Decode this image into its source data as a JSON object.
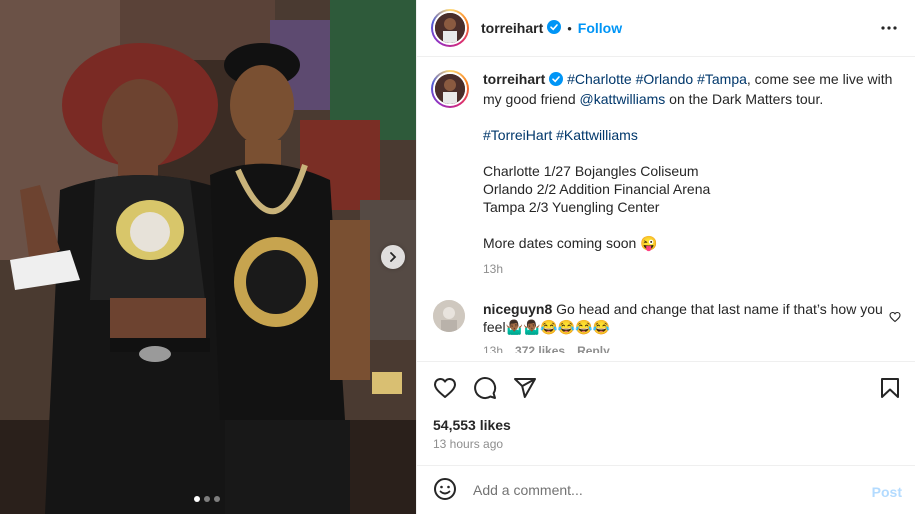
{
  "colors": {
    "link": "#0095f6",
    "hashtag": "#00376b",
    "muted": "#8e8e8e",
    "post_disabled": "#b3dbff"
  },
  "media": {
    "carousel_dots": 3,
    "active_dot": 0,
    "next_icon": "chevron-right-icon"
  },
  "header": {
    "username": "torreihart",
    "separator": "•",
    "follow_label": "Follow",
    "more_icon": "more-horizontal-icon"
  },
  "caption": {
    "username": "torreihart",
    "hashtags_line1": [
      "#Charlotte",
      "#Orlando",
      "#Tampa"
    ],
    "text1a": ", come see me live with my good friend ",
    "mention": "@kattwilliams",
    "text1b": " on the Dark Matters tour.",
    "hashtags_line2": [
      "#TorreiHart",
      "#Kattwilliams"
    ],
    "dates": [
      "Charlotte 1/27 Bojangles Coliseum",
      "Orlando 2/2 Addition Financial Arena",
      "Tampa 2/3 Yuengling Center"
    ],
    "more_dates": "More dates coming soon 😜",
    "time": "13h"
  },
  "comment": {
    "username": "niceguyn8",
    "text": "Go head and change that last name if that’s how you feel🤷🏾‍♂️🤷🏾‍♂️😂😂😂😂",
    "time": "13h",
    "likes": "372 likes",
    "reply": "Reply"
  },
  "actions": {
    "like_icon": "heart-icon",
    "comment_icon": "comment-icon",
    "share_icon": "send-icon",
    "save_icon": "bookmark-icon",
    "likes_count": "54,553 likes",
    "time_ago": "13 hours ago"
  },
  "add_comment": {
    "placeholder": "Add a comment...",
    "emoji_icon": "emoji-icon",
    "post_label": "Post"
  }
}
